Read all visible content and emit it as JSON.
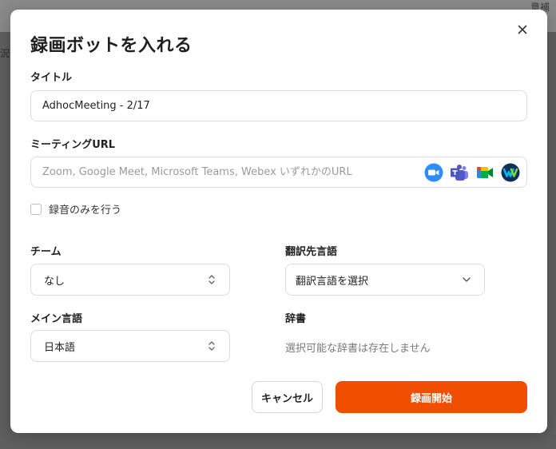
{
  "background": {
    "corner_text": "意補",
    "left_text": "況と"
  },
  "modal": {
    "title": "録画ボットを入れる",
    "title_field": {
      "label": "タイトル",
      "value": "AdhocMeeting - 2/17"
    },
    "url_field": {
      "label": "ミーティングURL",
      "placeholder": "Zoom, Google Meet, Microsoft Teams, Webex いずれかのURL",
      "service_icons": [
        "zoom-icon",
        "microsoft-teams-icon",
        "google-meet-icon",
        "webex-icon"
      ]
    },
    "audio_only": {
      "label": "録音のみを行う",
      "checked": false
    },
    "team": {
      "label": "チーム",
      "value": "なし"
    },
    "translation": {
      "label": "翻訳先言語",
      "placeholder": "翻訳言語を選択"
    },
    "main_language": {
      "label": "メイン言語",
      "value": "日本語"
    },
    "dictionary": {
      "label": "辞書",
      "empty_text": "選択可能な辞書は存在しません"
    },
    "buttons": {
      "cancel": "キャンセル",
      "start": "録画開始"
    }
  },
  "colors": {
    "accent": "#F04E00",
    "overlay": "#5F5F5F"
  }
}
